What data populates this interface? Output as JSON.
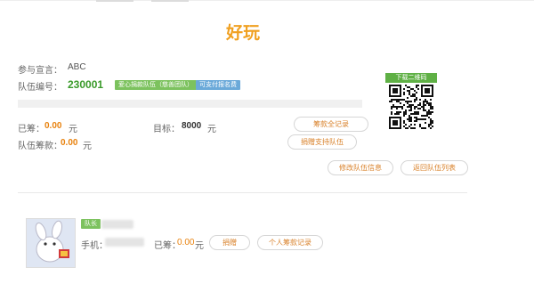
{
  "page": {
    "title": "好玩"
  },
  "team": {
    "declaration_label": "参与宣言：",
    "declaration_value": "ABC",
    "team_no_label": "队伍编号：",
    "team_no_value": "230001",
    "tag_love_team": "爱心捐款队伍（慈善团队）",
    "tag_can_donate": "可支付报名费",
    "raised_label": "已筹：",
    "raised_value": "0.00",
    "raised_unit": "元",
    "target_label": "目标：",
    "target_value": "8000",
    "target_unit": "元",
    "team_donation_label": "队伍筹款：",
    "team_donation_value": "0.00",
    "team_donation_unit": "元",
    "progress_fraction": 0.0
  },
  "qr": {
    "download_label": "下载二维码"
  },
  "buttons": {
    "all_donation_records": "筹款全记录",
    "donate_support_team": "捐赠支持队伍",
    "edit_team_info": "修改队伍信息",
    "back_to_team_list": "返回队伍列表",
    "donate": "捐赠",
    "personal_records": "个人筹款记录"
  },
  "member": {
    "tag": "队长",
    "phone_label": "手机：",
    "raised_label": "已筹：",
    "raised_value": "0.00",
    "raised_unit": "元"
  },
  "colors": {
    "title": "#f0a020",
    "team_no": "#3a9a2a",
    "amount": "#e8820e",
    "button_text": "#d9822b",
    "tag_green": "#7cc25e",
    "tag_blue": "#6aa9d9"
  }
}
